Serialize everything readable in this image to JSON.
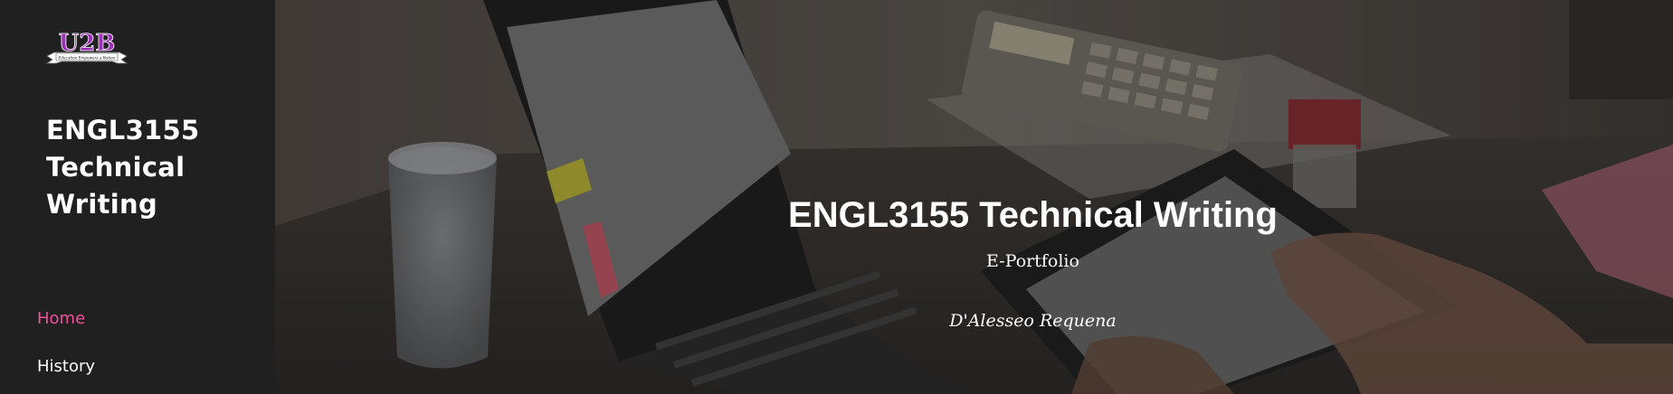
{
  "sidebar": {
    "logo": {
      "icon": "u2b-logo",
      "text": "U2B",
      "tagline": "Education Empowers a Nation"
    },
    "site_title": "ENGL3155 Technical Writing",
    "nav": [
      {
        "label": "Home",
        "active": true
      },
      {
        "label": "History",
        "active": false
      }
    ]
  },
  "hero": {
    "title": "ENGL3155 Technical Writing",
    "subtitle": "E-Portfolio",
    "author": "D'Alesseo Requena",
    "background": "desk-laptop-tablet-photo"
  },
  "colors": {
    "sidebar_bg": "#202020",
    "nav_active": "#f0509a",
    "logo_purple": "#9b2fb5"
  }
}
